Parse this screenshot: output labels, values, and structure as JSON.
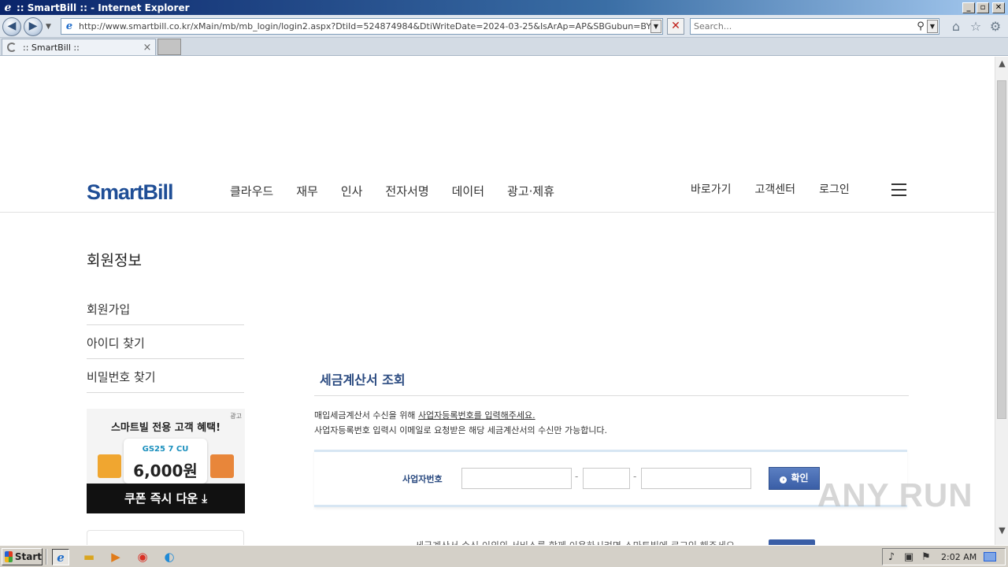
{
  "browser": {
    "window_title": ":: SmartBill :: - Internet Explorer",
    "url": "http://www.smartbill.co.kr/xMain/mb/mb_login/login2.aspx?DtiId=524874984&DtiWriteDate=2024-03-25&IsArAp=AP&SBGubun=BYR&Signal=ARISSU",
    "search_placeholder": "Search...",
    "tab_title": ":: SmartBill ::",
    "minimize_label": "_",
    "maximize_label": "▫",
    "close_label": "✕"
  },
  "header": {
    "logo": "SmartBill",
    "nav": [
      "클라우드",
      "재무",
      "인사",
      "전자서명",
      "데이터",
      "광고·제휴"
    ],
    "util": [
      "바로가기",
      "고객센터",
      "로그인"
    ]
  },
  "sidebar": {
    "title": "회원정보",
    "items": [
      "회원가입",
      "아이디 찾기",
      "비밀번호 찾기"
    ],
    "banner": {
      "ad_tag": "광고",
      "title": "스마트빌 전용 고객 혜택!",
      "brands": "GS25  7  CU",
      "amount": "6,000원",
      "cta": "쿠폰 즉시 다운 ⤓"
    }
  },
  "main": {
    "section_title": "세금계산서 조회",
    "desc1_prefix": "매입세금계산서 수신을 위해 ",
    "desc1_link": "사업자등록번호를 입력해주세요.",
    "desc2": "사업자등록번호 입력시 이메일로 요청받은 해당 세금계산서의 수신만 가능합니다.",
    "form_label": "사업자번호",
    "dash": "-",
    "fields": [
      "",
      "",
      ""
    ],
    "confirm_button": "확인",
    "bottom_text": "세금계산서 수신 이외의 서비스를 함께 이용하시려면 스마트빌에 로그인 해주세요."
  },
  "watermark": "ANY RUN",
  "taskbar": {
    "start_label": "Start",
    "clock": "2:02 AM"
  },
  "icons": {
    "back": "back-arrow-icon",
    "forward": "forward-arrow-icon",
    "home": "home-icon",
    "favorites": "star-icon",
    "tools": "gear-icon"
  }
}
